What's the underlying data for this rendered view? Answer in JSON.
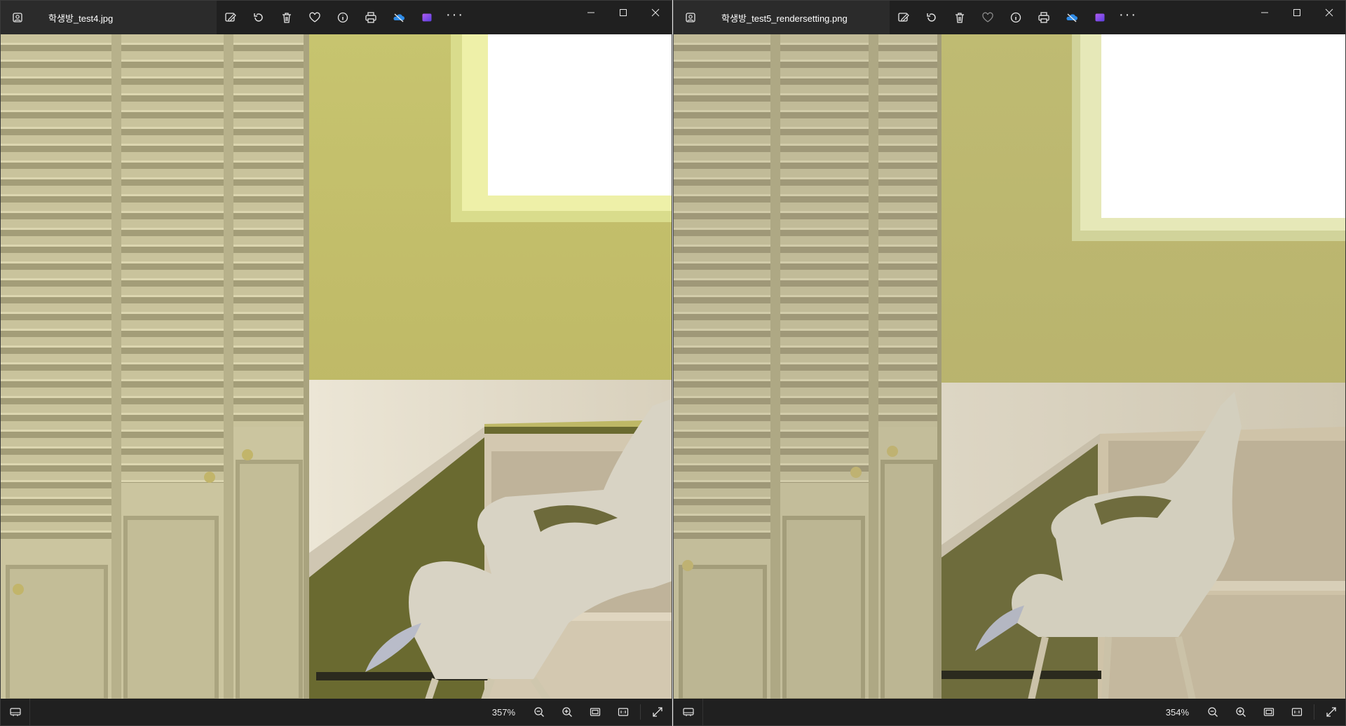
{
  "colors": {
    "titlebar": "#202020",
    "tab": "#2b2b2b",
    "wall": "#c4c072",
    "cabinet": "#cdc7a3",
    "desk": "#e5ded0",
    "chair": "#d8d4c8",
    "window_light": "#ffffff",
    "onedrive": "#2f8ce8",
    "clipchamp": "#8e4de6"
  },
  "windows": [
    {
      "id": "left",
      "filename": "학생방_test4.jpg",
      "zoom_level": "357%"
    },
    {
      "id": "right",
      "filename": "학생방_test5_rendersetting.png",
      "zoom_level": "354%"
    }
  ],
  "toolbar_icons": [
    "edit-image-icon",
    "rotate-icon",
    "delete-icon",
    "favorite-heart-icon",
    "info-icon",
    "print-icon",
    "onedrive-icon",
    "clipchamp-icon",
    "more-options-icon"
  ],
  "window_controls": [
    "minimize-icon",
    "maximize-icon",
    "close-icon"
  ],
  "status_icons": [
    "filmstrip-icon",
    "zoom-out-icon",
    "zoom-in-icon",
    "fit-to-window-icon",
    "actual-size-icon",
    "full-screen-icon"
  ]
}
